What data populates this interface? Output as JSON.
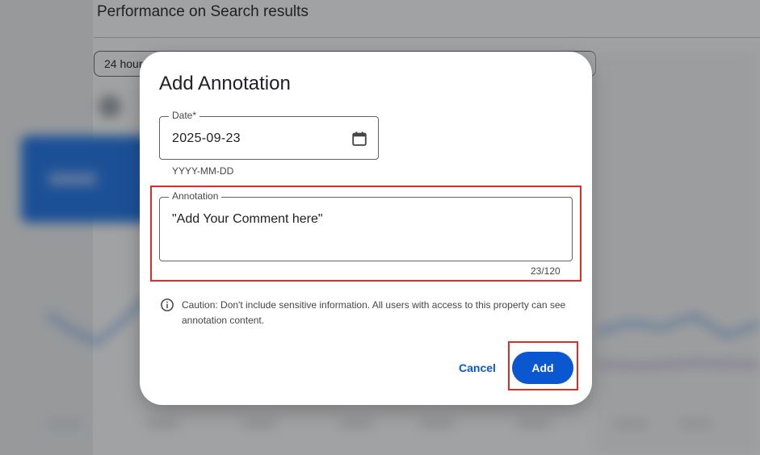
{
  "background": {
    "page_title": "Performance on Search results",
    "date_chip": "24 hours"
  },
  "dialog": {
    "title": "Add Annotation",
    "date_field": {
      "label": "Date*",
      "value": "2025-09-23",
      "hint": "YYYY-MM-DD",
      "icon": "calendar-icon"
    },
    "annotation_field": {
      "label": "Annotation",
      "value": "\"Add Your Comment here\"",
      "counter": "23/120"
    },
    "caution": {
      "icon": "info-icon",
      "text": "Caution: Don't include sensitive information. All users with access to this property can see annotation content."
    },
    "actions": {
      "cancel_label": "Cancel",
      "add_label": "Add"
    }
  },
  "colors": {
    "primary": "#0b57d0",
    "highlight": "#d93025"
  }
}
